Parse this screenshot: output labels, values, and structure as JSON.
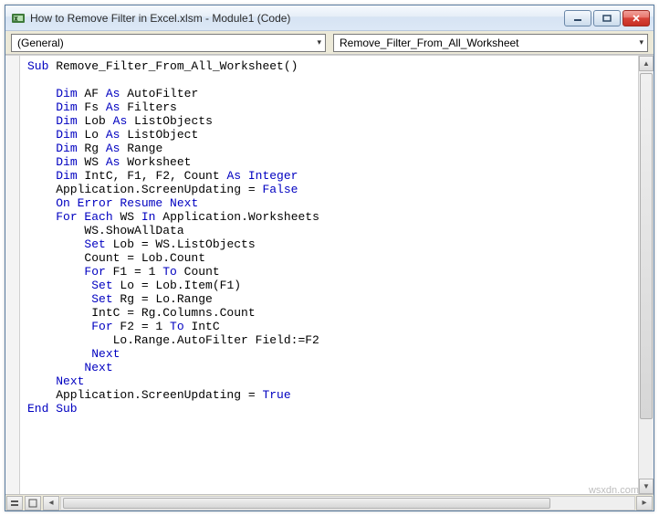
{
  "window": {
    "title": "How to Remove Filter in Excel.xlsm - Module1 (Code)"
  },
  "dropdowns": {
    "left": "(General)",
    "right": "Remove_Filter_From_All_Worksheet"
  },
  "code": {
    "lines": [
      [
        [
          "kw",
          "Sub"
        ],
        [
          "",
          " Remove_Filter_From_All_Worksheet()"
        ]
      ],
      [
        [
          "",
          ""
        ]
      ],
      [
        [
          "",
          "    "
        ],
        [
          "kw",
          "Dim"
        ],
        [
          "",
          " AF "
        ],
        [
          "kw",
          "As"
        ],
        [
          "",
          " AutoFilter"
        ]
      ],
      [
        [
          "",
          "    "
        ],
        [
          "kw",
          "Dim"
        ],
        [
          "",
          " Fs "
        ],
        [
          "kw",
          "As"
        ],
        [
          "",
          " Filters"
        ]
      ],
      [
        [
          "",
          "    "
        ],
        [
          "kw",
          "Dim"
        ],
        [
          "",
          " Lob "
        ],
        [
          "kw",
          "As"
        ],
        [
          "",
          " ListObjects"
        ]
      ],
      [
        [
          "",
          "    "
        ],
        [
          "kw",
          "Dim"
        ],
        [
          "",
          " Lo "
        ],
        [
          "kw",
          "As"
        ],
        [
          "",
          " ListObject"
        ]
      ],
      [
        [
          "",
          "    "
        ],
        [
          "kw",
          "Dim"
        ],
        [
          "",
          " Rg "
        ],
        [
          "kw",
          "As"
        ],
        [
          "",
          " Range"
        ]
      ],
      [
        [
          "",
          "    "
        ],
        [
          "kw",
          "Dim"
        ],
        [
          "",
          " WS "
        ],
        [
          "kw",
          "As"
        ],
        [
          "",
          " Worksheet"
        ]
      ],
      [
        [
          "",
          "    "
        ],
        [
          "kw",
          "Dim"
        ],
        [
          "",
          " IntC, F1, F2, Count "
        ],
        [
          "kw",
          "As Integer"
        ]
      ],
      [
        [
          "",
          "    Application.ScreenUpdating = "
        ],
        [
          "kw",
          "False"
        ]
      ],
      [
        [
          "",
          "    "
        ],
        [
          "kw",
          "On Error Resume Next"
        ]
      ],
      [
        [
          "",
          "    "
        ],
        [
          "kw",
          "For Each"
        ],
        [
          "",
          " WS "
        ],
        [
          "kw",
          "In"
        ],
        [
          "",
          " Application.Worksheets"
        ]
      ],
      [
        [
          "",
          "        WS.ShowAllData"
        ]
      ],
      [
        [
          "",
          "        "
        ],
        [
          "kw",
          "Set"
        ],
        [
          "",
          " Lob = WS.ListObjects"
        ]
      ],
      [
        [
          "",
          "        Count = Lob.Count"
        ]
      ],
      [
        [
          "",
          "        "
        ],
        [
          "kw",
          "For"
        ],
        [
          "",
          " F1 = 1 "
        ],
        [
          "kw",
          "To"
        ],
        [
          "",
          " Count"
        ]
      ],
      [
        [
          "",
          "         "
        ],
        [
          "kw",
          "Set"
        ],
        [
          "",
          " Lo = Lob.Item(F1)"
        ]
      ],
      [
        [
          "",
          "         "
        ],
        [
          "kw",
          "Set"
        ],
        [
          "",
          " Rg = Lo.Range"
        ]
      ],
      [
        [
          "",
          "         IntC = Rg.Columns.Count"
        ]
      ],
      [
        [
          "",
          "         "
        ],
        [
          "kw",
          "For"
        ],
        [
          "",
          " F2 = 1 "
        ],
        [
          "kw",
          "To"
        ],
        [
          "",
          " IntC"
        ]
      ],
      [
        [
          "",
          "            Lo.Range.AutoFilter Field:=F2"
        ]
      ],
      [
        [
          "",
          "         "
        ],
        [
          "kw",
          "Next"
        ]
      ],
      [
        [
          "",
          "        "
        ],
        [
          "kw",
          "Next"
        ]
      ],
      [
        [
          "",
          "    "
        ],
        [
          "kw",
          "Next"
        ]
      ],
      [
        [
          "",
          "    Application.ScreenUpdating = "
        ],
        [
          "kw",
          "True"
        ]
      ],
      [
        [
          "kw",
          "End Sub"
        ]
      ]
    ]
  },
  "watermark": "wsxdn.com"
}
